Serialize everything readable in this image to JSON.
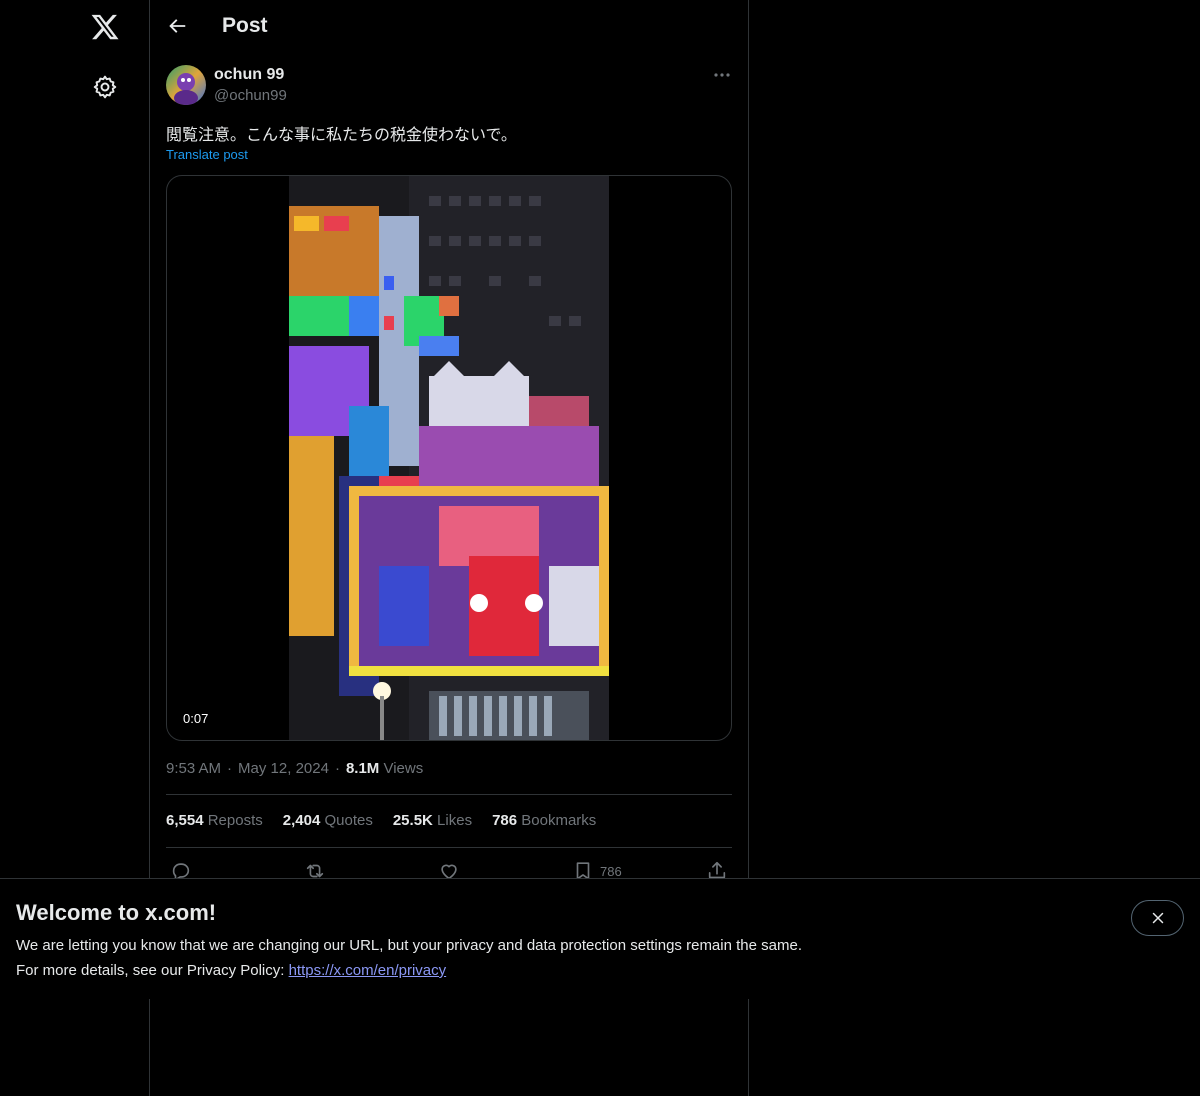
{
  "header": {
    "title": "Post"
  },
  "post": {
    "author_name": "ochun 99",
    "author_handle": "@ochun99",
    "text": "閲覧注意。こんな事に私たちの税金使わないで。",
    "translate_label": "Translate post",
    "video_duration": "0:07",
    "time": "9:53 AM",
    "date": "May 12, 2024",
    "views_count": "8.1M",
    "views_label": "Views",
    "separator": "·"
  },
  "stats": {
    "reposts_count": "6,554",
    "reposts_label": "Reposts",
    "quotes_count": "2,404",
    "quotes_label": "Quotes",
    "likes_count": "25.5K",
    "likes_label": "Likes",
    "bookmarks_count": "786",
    "bookmarks_label": "Bookmarks"
  },
  "actions": {
    "bookmark_count": "786"
  },
  "banner": {
    "title": "Welcome to x.com!",
    "line1": "We are letting you know that we are changing our URL, but your privacy and data protection settings remain the same.",
    "line2_prefix": "For more details, see our Privacy Policy: ",
    "link_text": "https://x.com/en/privacy"
  },
  "icons": {
    "logo": "x-logo-icon",
    "settings": "gear-icon",
    "back": "arrow-left-icon",
    "more": "more-horizontal-icon",
    "reply": "reply-icon",
    "repost": "repost-icon",
    "like": "heart-icon",
    "bookmark": "bookmark-icon",
    "share": "share-icon",
    "close": "close-icon"
  },
  "colors": {
    "background": "#000000",
    "text": "#e7e9ea",
    "muted": "#71767b",
    "accent": "#1d9bf0",
    "border": "#2f3336",
    "link": "#8b98f5"
  }
}
